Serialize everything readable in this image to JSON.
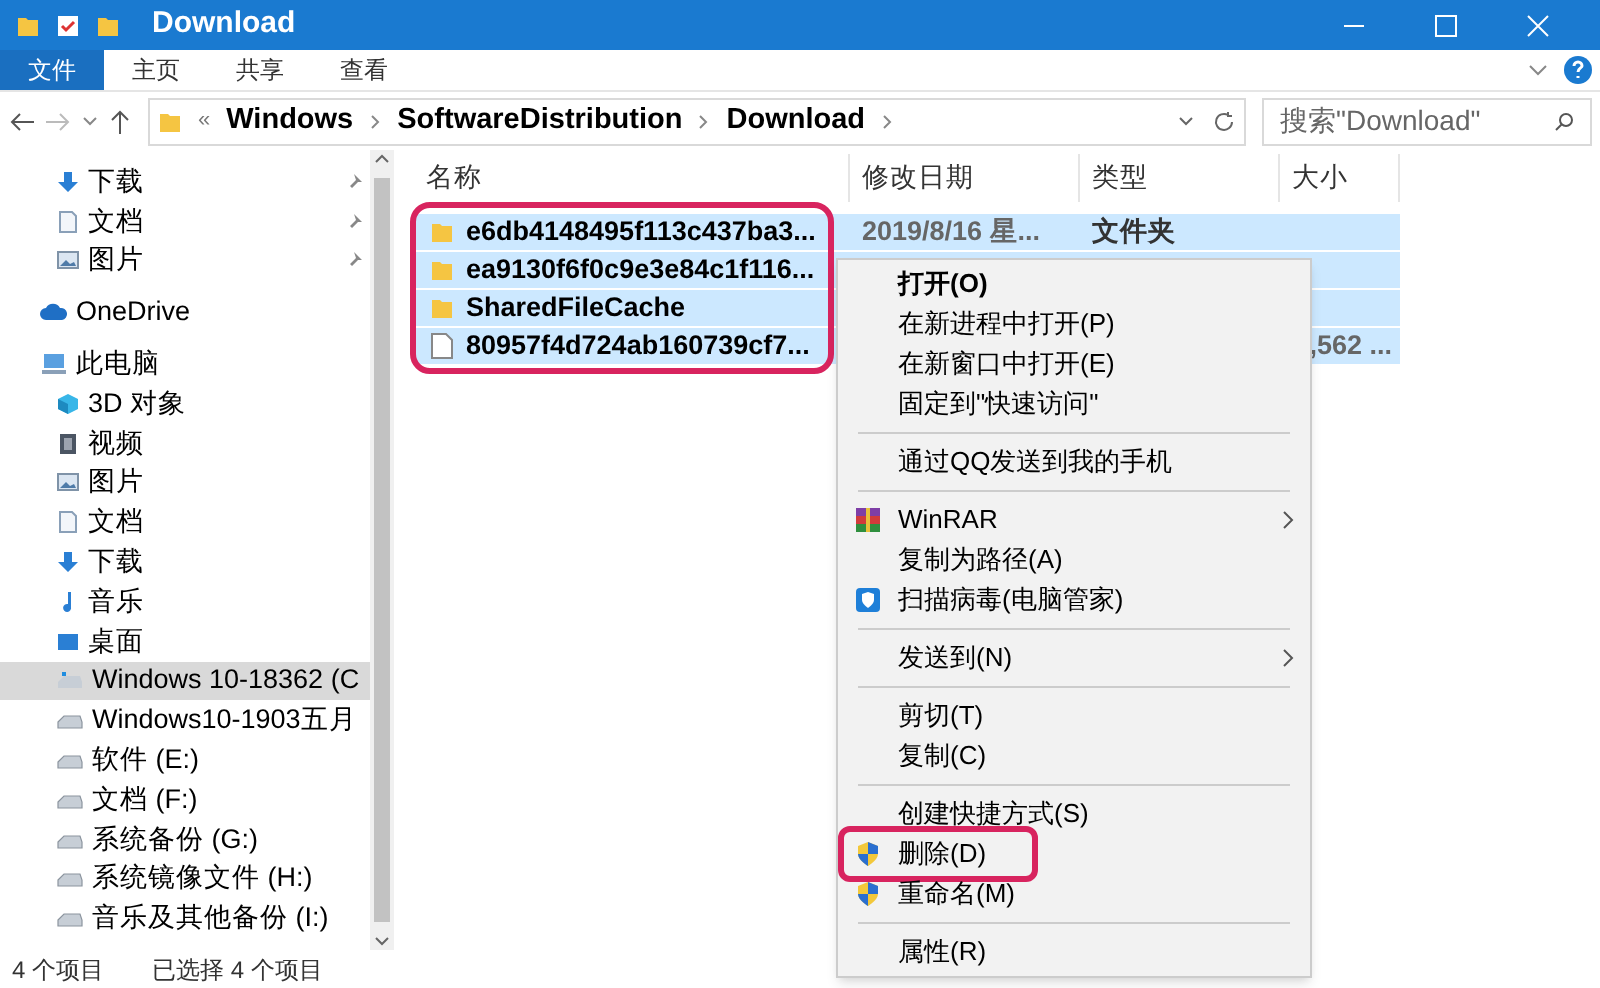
{
  "window": {
    "title": "Download"
  },
  "ribbon_tabs": [
    {
      "label": "文件",
      "selected": true
    },
    {
      "label": "主页",
      "selected": false
    },
    {
      "label": "共享",
      "selected": false
    },
    {
      "label": "查看",
      "selected": false
    }
  ],
  "address": {
    "overflow": "«",
    "segments": [
      "Windows",
      "SoftwareDistribution",
      "Download"
    ]
  },
  "search": {
    "placeholder": "搜索\"Download\""
  },
  "nav": [
    {
      "label": "下载",
      "kind": "download",
      "pinned": true,
      "selected": false
    },
    {
      "label": "文档",
      "kind": "document",
      "pinned": true,
      "selected": false
    },
    {
      "label": "图片",
      "kind": "picture",
      "pinned": true,
      "selected": false
    },
    {
      "label": "OneDrive",
      "kind": "cloud",
      "pinned": false,
      "selected": false
    },
    {
      "label": "此电脑",
      "kind": "computer",
      "pinned": false,
      "selected": false,
      "children": [
        {
          "label": "3D 对象",
          "kind": "cube",
          "selected": false
        },
        {
          "label": "视频",
          "kind": "video",
          "selected": false
        },
        {
          "label": "图片",
          "kind": "picture",
          "selected": false
        },
        {
          "label": "文档",
          "kind": "document",
          "selected": false
        },
        {
          "label": "下载",
          "kind": "download",
          "selected": false
        },
        {
          "label": "音乐",
          "kind": "music",
          "selected": false
        },
        {
          "label": "桌面",
          "kind": "desktop",
          "selected": false
        },
        {
          "label": "Windows 10-18362 (C",
          "kind": "system-drive",
          "selected": true
        },
        {
          "label": "Windows10-1903五月",
          "kind": "drive",
          "selected": false
        },
        {
          "label": "软件 (E:)",
          "kind": "drive",
          "selected": false
        },
        {
          "label": "文档 (F:)",
          "kind": "drive",
          "selected": false
        },
        {
          "label": "系统备份 (G:)",
          "kind": "drive",
          "selected": false
        },
        {
          "label": "系统镜像文件 (H:)",
          "kind": "drive",
          "selected": false
        },
        {
          "label": "音乐及其他备份 (I:)",
          "kind": "drive",
          "selected": false
        }
      ]
    }
  ],
  "columns": [
    "名称",
    "修改日期",
    "类型",
    "大小"
  ],
  "files": [
    {
      "name": "e6db4148495f113c437ba3...",
      "kind": "folder",
      "date": "2019/8/16 星...",
      "type": "文件夹",
      "selected": true
    },
    {
      "name": "ea9130f6f0c9e3e84c1f116...",
      "kind": "folder",
      "selected": true
    },
    {
      "name": "SharedFileCache",
      "kind": "folder",
      "selected": true
    },
    {
      "name": "80957f4d724ab160739cf7...",
      "kind": "file",
      "size": ",562 ...",
      "selected": true
    }
  ],
  "files_annotated": true,
  "context_menu": [
    {
      "label": "打开(O)",
      "bold": true,
      "kind": "none",
      "submenu": false,
      "separator_after": false,
      "annotated": false
    },
    {
      "label": "在新进程中打开(P)",
      "bold": false,
      "kind": "none",
      "submenu": false,
      "separator_after": false,
      "annotated": false
    },
    {
      "label": "在新窗口中打开(E)",
      "bold": false,
      "kind": "none",
      "submenu": false,
      "separator_after": false,
      "annotated": false
    },
    {
      "label": "固定到\"快速访问\"",
      "bold": false,
      "kind": "none",
      "submenu": false,
      "separator_after": true,
      "annotated": false
    },
    {
      "label": "通过QQ发送到我的手机",
      "bold": false,
      "kind": "none",
      "submenu": false,
      "separator_after": true,
      "annotated": false
    },
    {
      "label": "WinRAR",
      "bold": false,
      "kind": "archive",
      "submenu": true,
      "separator_after": false,
      "annotated": false
    },
    {
      "label": "复制为路径(A)",
      "bold": false,
      "kind": "none",
      "submenu": false,
      "separator_after": false,
      "annotated": false
    },
    {
      "label": "扫描病毒(电脑管家)",
      "bold": false,
      "kind": "shield-blue",
      "submenu": false,
      "separator_after": true,
      "annotated": false
    },
    {
      "label": "发送到(N)",
      "bold": false,
      "kind": "none",
      "submenu": true,
      "separator_after": true,
      "annotated": false
    },
    {
      "label": "剪切(T)",
      "bold": false,
      "kind": "none",
      "submenu": false,
      "separator_after": false,
      "annotated": false
    },
    {
      "label": "复制(C)",
      "bold": false,
      "kind": "none",
      "submenu": false,
      "separator_after": true,
      "annotated": false
    },
    {
      "label": "创建快捷方式(S)",
      "bold": false,
      "kind": "none",
      "submenu": false,
      "separator_after": false,
      "annotated": false
    },
    {
      "label": "删除(D)",
      "bold": false,
      "kind": "uac-shield",
      "submenu": false,
      "separator_after": false,
      "annotated": true
    },
    {
      "label": "重命名(M)",
      "bold": false,
      "kind": "uac-shield",
      "submenu": false,
      "separator_after": true,
      "annotated": false
    },
    {
      "label": "属性(R)",
      "bold": false,
      "kind": "none",
      "submenu": false,
      "separator_after": false,
      "annotated": false
    }
  ],
  "status_bar": {
    "count": "4 个项目",
    "selection": "已选择 4 个项目"
  }
}
